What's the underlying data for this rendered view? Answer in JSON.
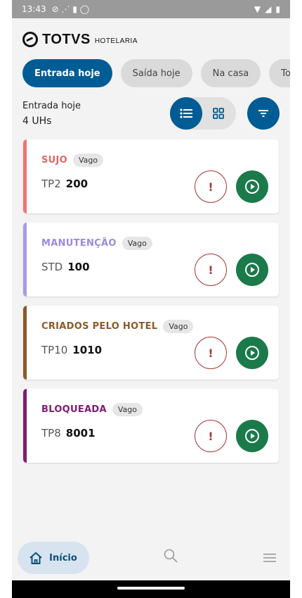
{
  "status_bar": {
    "time": "13:43"
  },
  "brand": {
    "name": "TOTVS",
    "product": "HOTELARIA"
  },
  "filters": [
    {
      "label": "Entrada hoje",
      "active": true
    },
    {
      "label": "Saída hoje",
      "active": false
    },
    {
      "label": "Na casa",
      "active": false
    },
    {
      "label": "To",
      "active": false
    }
  ],
  "summary": {
    "title": "Entrada hoje",
    "count": "4 UHs"
  },
  "rooms": [
    {
      "status": "SUJO",
      "status_color": "#e06666",
      "badge": "Vago",
      "type": "TP2",
      "number": "200"
    },
    {
      "status": "MANUTENÇÃO",
      "status_color": "#9a8ae0",
      "badge": "Vago",
      "type": "STD",
      "number": "100"
    },
    {
      "status": "CRIADOS PELO HOTEL",
      "status_color": "#8a5a2b",
      "badge": "Vago",
      "type": "TP10",
      "number": "1010"
    },
    {
      "status": "BLOQUEADA",
      "status_color": "#7e1b74",
      "badge": "Vago",
      "type": "TP8",
      "number": "8001"
    }
  ],
  "bottom_nav": {
    "home_label": "Início"
  },
  "colors": {
    "primary": "#005c94",
    "success": "#1b7a4a",
    "danger": "#a63a3a"
  }
}
